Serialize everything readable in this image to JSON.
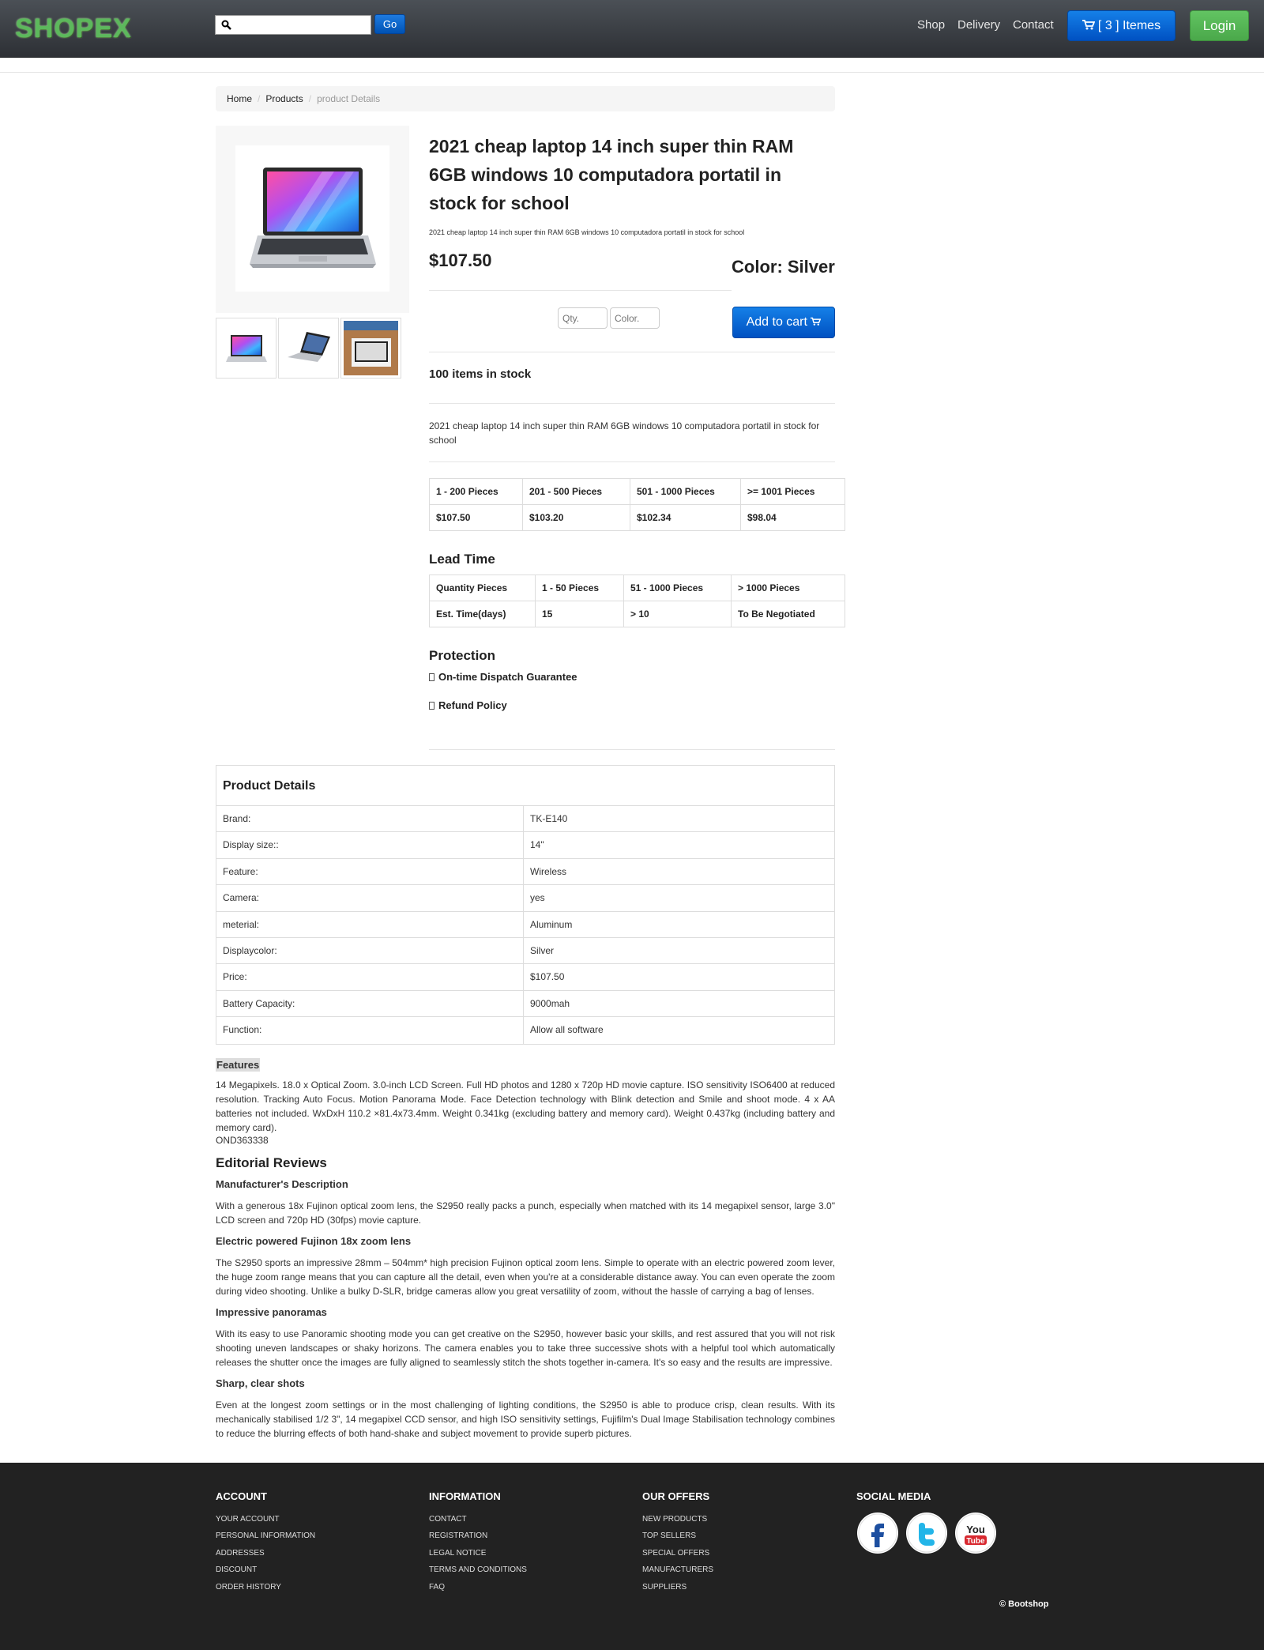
{
  "header": {
    "logo": "SHOPEX",
    "search_placeholder": "",
    "go_label": "Go",
    "nav": [
      "Shop",
      "Delivery",
      "Contact"
    ],
    "cart_label": "[ 3 ] Itemes",
    "login_label": "Login"
  },
  "breadcrumb": [
    "Home",
    "Products",
    "product Details"
  ],
  "product": {
    "title": "2021 cheap laptop 14 inch super thin RAM 6GB windows 10 computadora portatil in stock for school",
    "subtitle": "2021 cheap laptop 14 inch super thin RAM 6GB windows 10 computadora portatil in stock for school",
    "price": "$107.50",
    "color_label": "Color: Silver",
    "qty_placeholder": "Qty.",
    "color_placeholder": "Color.",
    "add_to_cart": "Add to cart",
    "stock": "100 items in stock",
    "description": "2021 cheap laptop 14 inch super thin RAM 6GB windows 10 computadora portatil in stock for school"
  },
  "price_tiers": {
    "ranges": [
      "1 - 200 Pieces",
      "201 - 500 Pieces",
      "501 - 1000 Pieces",
      ">= 1001 Pieces"
    ],
    "prices": [
      "$107.50",
      "$103.20",
      "$102.34",
      "$98.04"
    ]
  },
  "lead_time": {
    "heading": "Lead Time",
    "row1": [
      "Quantity Pieces",
      "1 - 50 Pieces",
      "51 - 1000 Pieces",
      "> 1000 Pieces"
    ],
    "row2": [
      "Est. Time(days)",
      "15",
      "> 10",
      "To Be Negotiated"
    ]
  },
  "protection": {
    "heading": "Protection",
    "items": [
      "On-time Dispatch Guarantee",
      "Refund Policy"
    ]
  },
  "details": {
    "heading": "Product Details",
    "rows": [
      {
        "k": "Brand:",
        "v": "TK-E140"
      },
      {
        "k": "Display size::",
        "v": "14\""
      },
      {
        "k": "Feature:",
        "v": "Wireless"
      },
      {
        "k": "Camera:",
        "v": "yes"
      },
      {
        "k": "meterial:",
        "v": "Aluminum"
      },
      {
        "k": "Displaycolor:",
        "v": "Silver"
      },
      {
        "k": "Price:",
        "v": "$107.50"
      },
      {
        "k": "Battery Capacity:",
        "v": "9000mah"
      },
      {
        "k": "Function:",
        "v": "Allow all software"
      }
    ]
  },
  "features": {
    "label": "Features",
    "text": "14 Megapixels. 18.0 x Optical Zoom. 3.0-inch LCD Screen. Full HD photos and 1280 x 720p HD movie capture. ISO sensitivity ISO6400 at reduced resolution. Tracking Auto Focus. Motion Panorama Mode. Face Detection technology with Blink detection and Smile and shoot mode. 4 x AA batteries not included. WxDxH 110.2 ×81.4x73.4mm. Weight 0.341kg (excluding battery and memory card). Weight 0.437kg (including battery and memory card).",
    "code": "OND363338"
  },
  "reviews": {
    "heading": "Editorial Reviews",
    "sections": [
      {
        "title": "Manufacturer's Description",
        "text": "With a generous 18x Fujinon optical zoom lens, the S2950 really packs a punch, especially when matched with its 14 megapixel sensor, large 3.0\" LCD screen and 720p HD (30fps) movie capture."
      },
      {
        "title": "Electric powered Fujinon 18x zoom lens",
        "text": "The S2950 sports an impressive 28mm – 504mm* high precision Fujinon optical zoom lens. Simple to operate with an electric powered zoom lever, the huge zoom range means that you can capture all the detail, even when you're at a considerable distance away. You can even operate the zoom during video shooting. Unlike a bulky D-SLR, bridge cameras allow you great versatility of zoom, without the hassle of carrying a bag of lenses."
      },
      {
        "title": "Impressive panoramas",
        "text": "With its easy to use Panoramic shooting mode you can get creative on the S2950, however basic your skills, and rest assured that you will not risk shooting uneven landscapes or shaky horizons. The camera enables you to take three successive shots with a helpful tool which automatically releases the shutter once the images are fully aligned to seamlessly stitch the shots together in-camera. It's so easy and the results are impressive."
      },
      {
        "title": "Sharp, clear shots",
        "text": "Even at the longest zoom settings or in the most challenging of lighting conditions, the S2950 is able to produce crisp, clean results. With its mechanically stabilised 1/2 3\", 14 megapixel CCD sensor, and high ISO sensitivity settings, Fujifilm's Dual Image Stabilisation technology combines to reduce the blurring effects of both hand-shake and subject movement to provide superb pictures."
      }
    ]
  },
  "footer": {
    "account": {
      "heading": "ACCOUNT",
      "links": [
        "YOUR ACCOUNT",
        "PERSONAL INFORMATION",
        "ADDRESSES",
        "DISCOUNT",
        "ORDER HISTORY"
      ]
    },
    "information": {
      "heading": "INFORMATION",
      "links": [
        "CONTACT",
        "REGISTRATION",
        "LEGAL NOTICE",
        "TERMS AND CONDITIONS",
        "FAQ"
      ]
    },
    "offers": {
      "heading": "OUR OFFERS",
      "links": [
        "NEW PRODUCTS",
        "TOP SELLERS",
        "SPECIAL OFFERS",
        "MANUFACTURERS",
        "SUPPLIERS"
      ]
    },
    "social": {
      "heading": "SOCIAL MEDIA",
      "icons": [
        "facebook-icon",
        "twitter-icon",
        "youtube-icon"
      ],
      "youtube_text": "You Tube"
    },
    "copyright": "© Bootshop"
  },
  "colors": {
    "brand_green": "#5cb85c",
    "primary_blue": "#0060d0",
    "header_bg": "#3a3e43",
    "footer_bg": "#222222"
  }
}
